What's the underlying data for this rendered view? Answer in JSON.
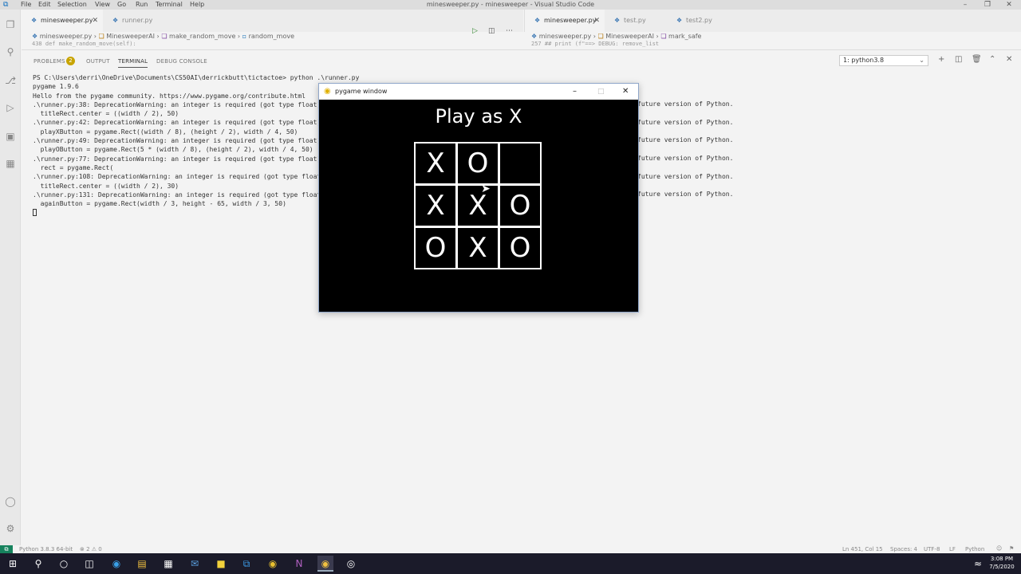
{
  "window": {
    "title": "minesweeper.py - minesweeper - Visual Studio Code"
  },
  "menu": [
    "File",
    "Edit",
    "Selection",
    "View",
    "Go",
    "Run",
    "Terminal",
    "Help"
  ],
  "left_tabs": [
    {
      "label": "minesweeper.py",
      "active": true
    },
    {
      "label": "runner.py",
      "active": false
    }
  ],
  "right_tabs": [
    {
      "label": "minesweeper.py",
      "active": true
    },
    {
      "label": "test.py",
      "active": false
    },
    {
      "label": "test2.py",
      "active": false
    }
  ],
  "left_breadcrumb": {
    "file": "minesweeper.py",
    "cls": "MinesweeperAI",
    "method": "make_random_move",
    "field": "random_move"
  },
  "right_breadcrumb": {
    "file": "minesweeper.py",
    "cls": "MinesweeperAI",
    "method": "mark_safe"
  },
  "left_code_line": "438        def make_random_move(self):",
  "right_code_line": "257    ##        print (f\"==> DEBUG: remove_list",
  "panel": {
    "tabs": [
      "PROBLEMS",
      "OUTPUT",
      "TERMINAL",
      "DEBUG CONSOLE"
    ],
    "problems_count": "2",
    "terminal_select": "1: python3.8"
  },
  "terminal_lines": [
    "PS C:\\Users\\derri\\OneDrive\\Documents\\CS50AI\\derrickbutt\\tictactoe> python .\\runner.py",
    "pygame 1.9.6",
    "Hello from the pygame community. https://www.pygame.org/contribute.html",
    ".\\runner.py:38: DeprecationWarning: an integer is required (got type float).",
    "  titleRect.center = ((width / 2), 50)",
    ".\\runner.py:42: DeprecationWarning: an integer is required (got type float).",
    "  playXButton = pygame.Rect((width / 8), (height / 2), width / 4, 50)",
    ".\\runner.py:49: DeprecationWarning: an integer is required (got type float).",
    "  playOButton = pygame.Rect(5 * (width / 8), (height / 2), width / 4, 50)",
    ".\\runner.py:77: DeprecationWarning: an integer is required (got type float).",
    "  rect = pygame.Rect(",
    ".\\runner.py:108: DeprecationWarning: an integer is required (got type float).",
    "  titleRect.center = ((width / 2), 30)",
    ".\\runner.py:131: DeprecationWarning: an integer is required (got type float).",
    "  againButton = pygame.Rect(width / 3, height - 65, width / 3, 50)"
  ],
  "terminal_right": [
    "future version of Python.",
    "future version of Python.",
    "future version of Python.",
    "future version of Python.",
    "future version of Python.",
    "future version of Python."
  ],
  "pygame": {
    "window_title": "pygame window",
    "heading": "Play as X",
    "board": [
      [
        "X",
        "O",
        ""
      ],
      [
        "X",
        "X",
        "O"
      ],
      [
        "O",
        "X",
        "O"
      ]
    ]
  },
  "status": {
    "python": "Python 3.8.3 64-bit",
    "errors": "⊗ 2 ⚠ 0",
    "position": "Ln 451, Col 15",
    "spaces": "Spaces: 4",
    "encoding": "UTF-8",
    "eol": "LF",
    "language": "Python"
  },
  "clock": {
    "time": "3:08 PM",
    "date": "7/5/2020"
  }
}
